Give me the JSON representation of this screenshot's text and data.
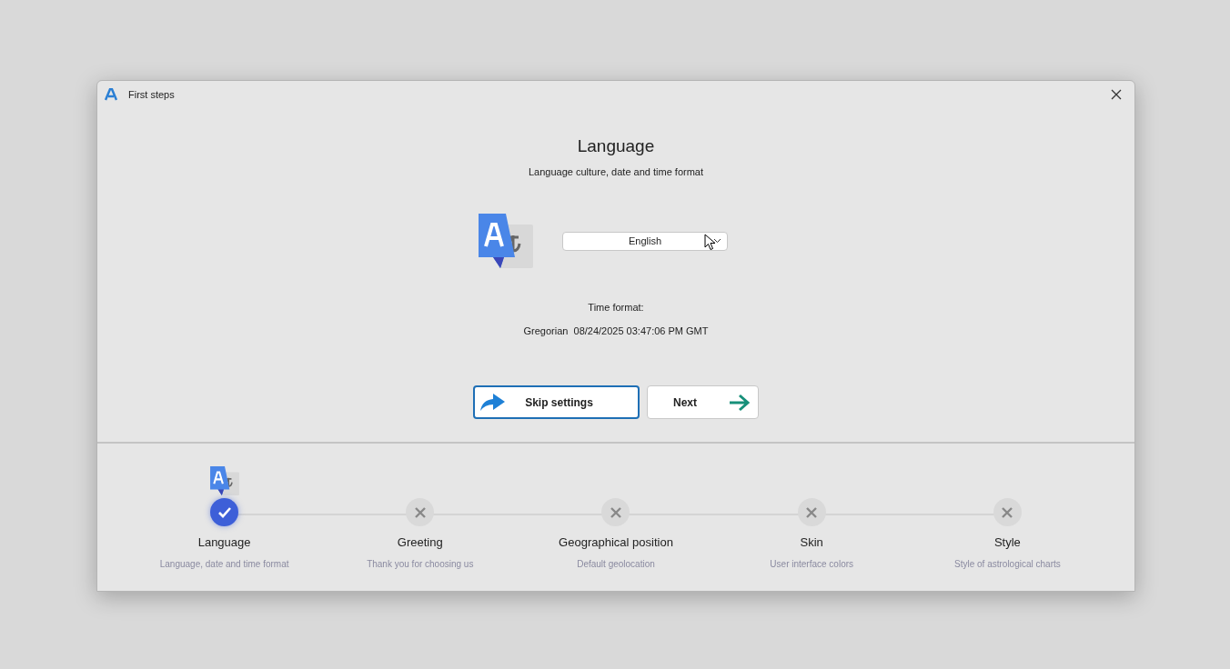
{
  "window": {
    "title": "First steps"
  },
  "header": {
    "title": "Language",
    "subtitle": "Language culture, date and time format"
  },
  "language_select": {
    "value": "English"
  },
  "time_format": {
    "label": "Time format:",
    "value": "Gregorian  08/24/2025 03:47:06 PM GMT"
  },
  "buttons": [
    {
      "kind": "skip",
      "label": "Skip settings"
    },
    {
      "kind": "next",
      "label": "Next"
    }
  ],
  "steps": [
    {
      "title": "Language",
      "subtitle": "Language, date and time format",
      "done": true
    },
    {
      "title": "Greeting",
      "subtitle": "Thank you for choosing us",
      "done": false
    },
    {
      "title": "Geographical position",
      "subtitle": "Default geolocation",
      "done": false
    },
    {
      "title": "Skin",
      "subtitle": "User interface colors",
      "done": false
    },
    {
      "title": "Style",
      "subtitle": "Style of astrological charts",
      "done": false
    }
  ]
}
